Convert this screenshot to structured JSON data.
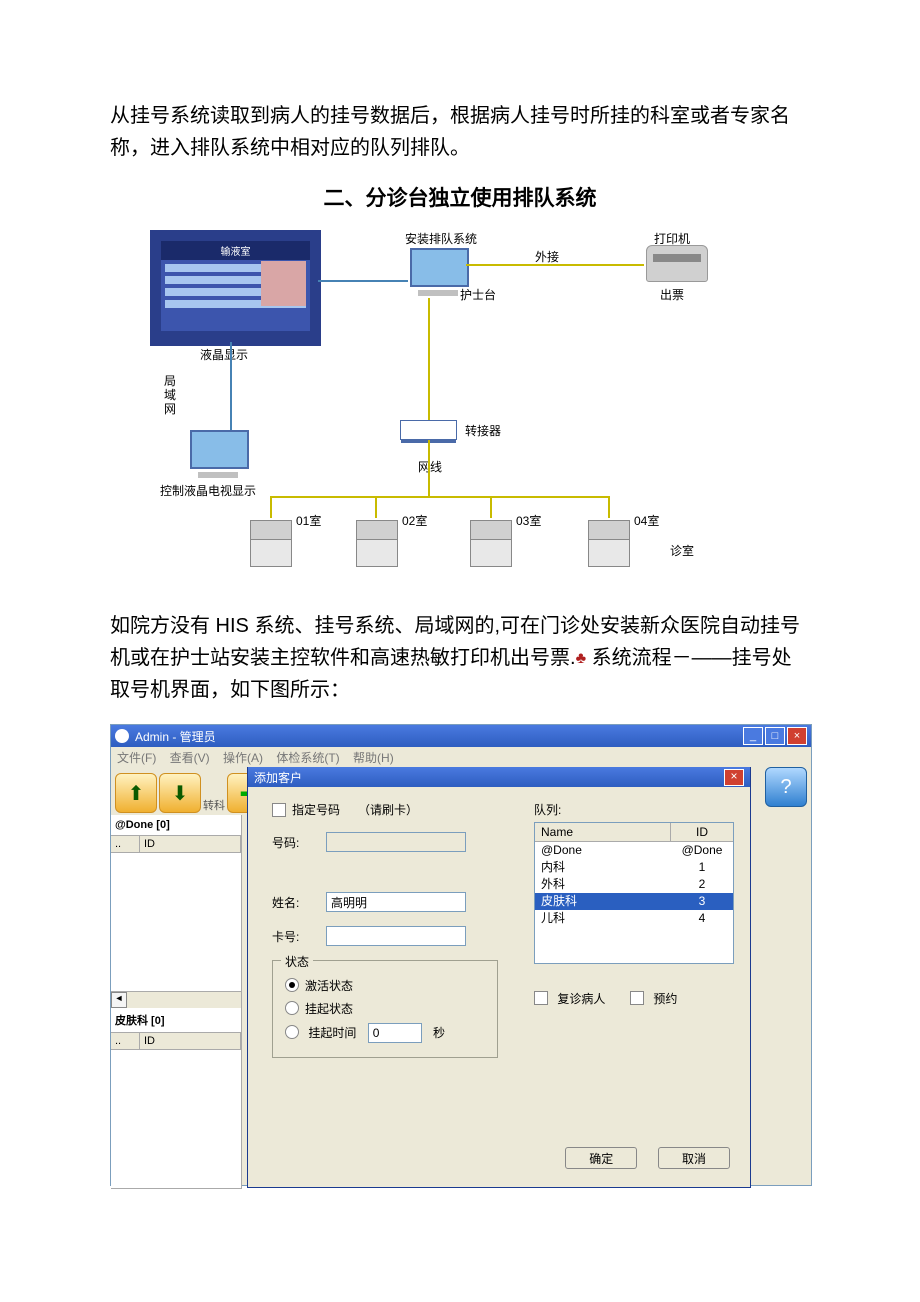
{
  "intro_para": "从挂号系统读取到病人的挂号数据后，根据病人挂号时所挂的科室或者专家名称，进入排队系统中相对应的队列排队。",
  "section_title": "二、分诊台独立使用排队系统",
  "diagram": {
    "tv_header": "输液室",
    "tv_caption": "液晶显示",
    "lan": "局域网",
    "ctrl_mon": "控制液晶电视显示",
    "install": "安装排队系统",
    "nurse": "护士台",
    "ext": "外接",
    "printer": "打印机",
    "ticket": "出票",
    "converter": "转接器",
    "cable": "网线",
    "rooms": [
      "01室",
      "02室",
      "03室",
      "04室"
    ],
    "room_area": "诊室"
  },
  "mid_para_a": "如院方没有 HIS 系统、挂号系统、局域网的,可在门诊处安装新众医院自动挂号机或在护士站安装主控软件和高速热敏打印机出号票.",
  "mid_para_b": " 系统流程－——挂号处取号机界面，如下图所示：",
  "app": {
    "title": "Admin - 管理员",
    "menu": [
      "文件(F)",
      "查看(V)",
      "操作(A)",
      "体检系统(T)",
      "帮助(H)"
    ],
    "tool_transfer": "转科",
    "left_done": "@Done [0]",
    "left_skin": "皮肤科 [0]",
    "col_id": "ID"
  },
  "dialog": {
    "title": "添加客户",
    "specify_chk": "指定号码",
    "swipe_hint": "（请刷卡）",
    "lbl_number": "号码:",
    "lbl_name": "姓名:",
    "name_value": "高明明",
    "lbl_card": "卡号:",
    "queue_label": "队列:",
    "queue_cols": {
      "name": "Name",
      "id": "ID"
    },
    "queue_rows": [
      {
        "name": "@Done",
        "id": "@Done"
      },
      {
        "name": "内科",
        "id": "1"
      },
      {
        "name": "外科",
        "id": "2"
      },
      {
        "name": "皮肤科",
        "id": "3",
        "sel": true
      },
      {
        "name": "儿科",
        "id": "4"
      }
    ],
    "grp_legend": "状态",
    "radio_active": "激活状态",
    "radio_hold": "挂起状态",
    "radio_hold_time": "挂起时间",
    "hold_time_val": "0",
    "hold_time_unit": "秒",
    "chk_revisit": "复诊病人",
    "chk_reserve": "预约",
    "btn_ok": "确定",
    "btn_cancel": "取消"
  }
}
